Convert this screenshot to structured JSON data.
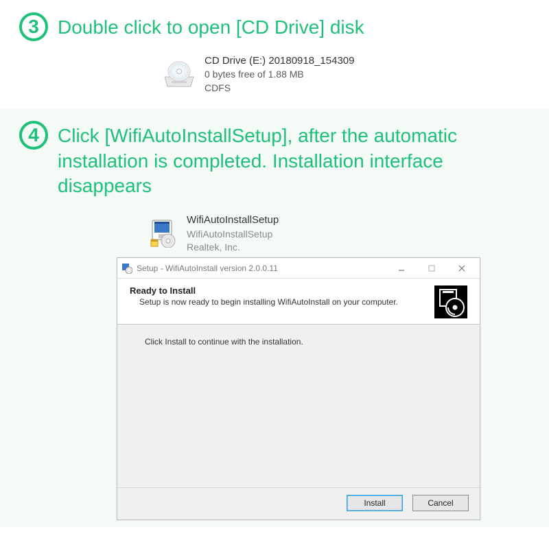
{
  "step3": {
    "num": "3",
    "text": "Double click to open [CD Drive] disk",
    "drive": {
      "name": "CD Drive (E:) 20180918_154309",
      "space": "0 bytes free of 1.88 MB",
      "fs": "CDFS"
    }
  },
  "step4": {
    "num": "4",
    "text": "Click [WifiAutoInstallSetup], after the automatic installation is completed. Installation interface disappears",
    "file": {
      "name": "WifiAutoInstallSetup",
      "desc": "WifiAutoInstallSetup",
      "vendor": "Realtek, Inc."
    },
    "dialog": {
      "title": "Setup - WifiAutoInstall version 2.0.0.11",
      "heading": "Ready to Install",
      "subheading": "Setup is now ready to begin installing WifiAutoInstall on your computer.",
      "body": "Click Install to continue with the installation.",
      "buttons": {
        "install": "Install",
        "cancel": "Cancel"
      }
    }
  }
}
